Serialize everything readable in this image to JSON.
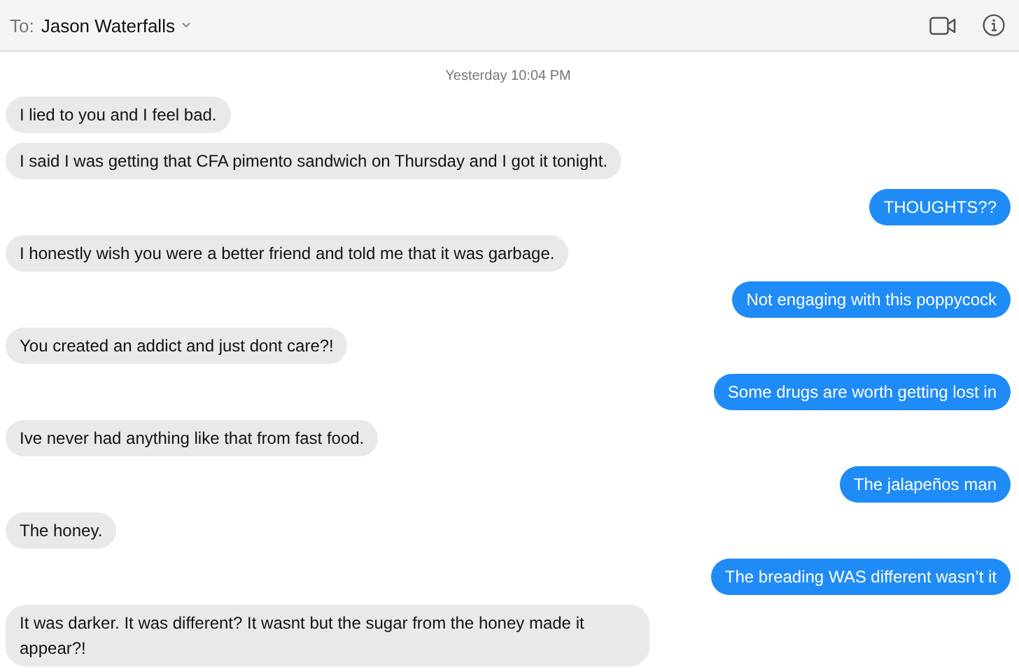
{
  "header": {
    "to_label": "To:",
    "recipient": "Jason Waterfalls"
  },
  "timestamp": "Yesterday 10:04 PM",
  "messages": [
    {
      "kind": "received",
      "text": "I lied to you and I feel bad."
    },
    {
      "kind": "received",
      "text": "I said I was getting that CFA pimento sandwich on Thursday and I got it tonight."
    },
    {
      "kind": "sent",
      "text": "THOUGHTS??"
    },
    {
      "kind": "received",
      "text": "I honestly wish you were a better friend and told me that it was garbage."
    },
    {
      "kind": "sent",
      "text": "Not engaging with this poppycock"
    },
    {
      "kind": "received",
      "text": "You created an addict and just dont care?!"
    },
    {
      "kind": "sent",
      "text": "Some drugs are worth getting lost in"
    },
    {
      "kind": "received",
      "text": "Ive never had anything like that from fast food."
    },
    {
      "kind": "sent",
      "text": "The jalapeños man"
    },
    {
      "kind": "received",
      "text": "The honey."
    },
    {
      "kind": "sent",
      "text": "The breading WAS different wasn’t it"
    },
    {
      "kind": "received",
      "text": "It was darker. It was different? It wasnt but the sugar from the honey made it appear?!"
    }
  ]
}
